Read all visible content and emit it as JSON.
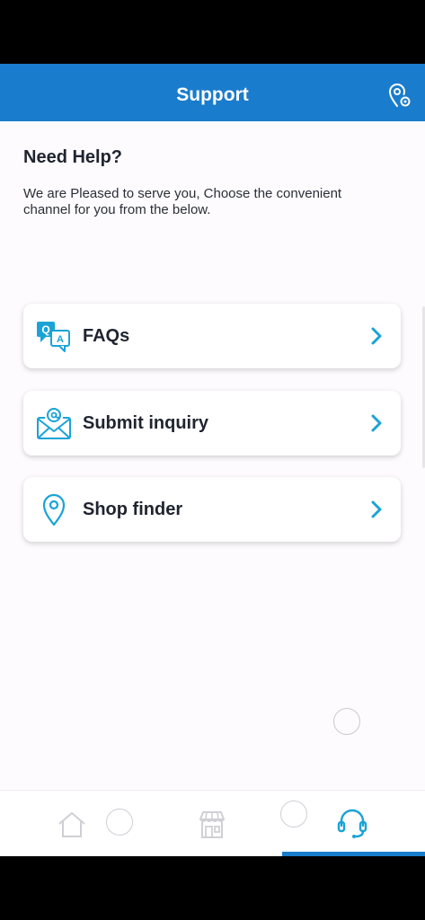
{
  "header": {
    "title": "Support",
    "action_icon": "location-settings-icon"
  },
  "help": {
    "title": "Need Help?",
    "description": "We are Pleased to serve you, Choose the convenient channel for you from the below."
  },
  "options": [
    {
      "label": "FAQs",
      "icon": "faq-chat-icon"
    },
    {
      "label": "Submit inquiry",
      "icon": "email-envelope-icon"
    },
    {
      "label": "Shop finder",
      "icon": "location-pin-icon"
    }
  ],
  "bottom_nav": [
    {
      "icon": "home-icon"
    },
    {
      "icon": "shop-icon"
    },
    {
      "icon": "headset-icon",
      "active": true
    }
  ],
  "colors": {
    "primary": "#1a7ccc",
    "accent": "#1aa3d6",
    "text": "#1f2430"
  },
  "faq_icon_letters": {
    "q": "Q",
    "a": "A"
  }
}
